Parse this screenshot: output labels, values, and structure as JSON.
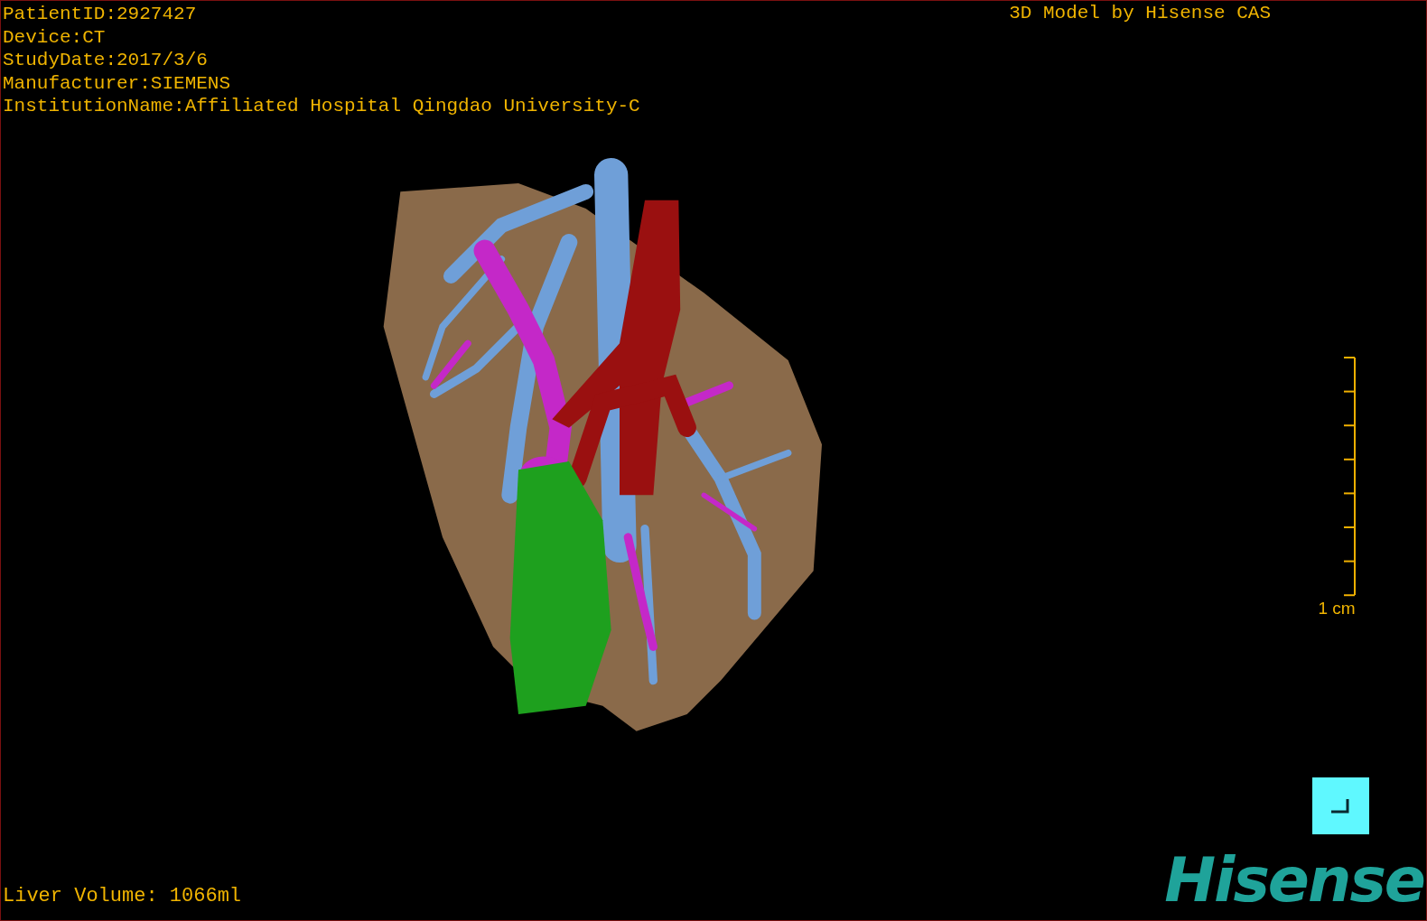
{
  "study_info": [
    "PatientID:2927427",
    "Device:CT",
    "StudyDate:2017/3/6",
    "Manufacturer:SIEMENS",
    "InstitutionName:Affiliated Hospital Qingdao University-C"
  ],
  "viewer_title": "3D Model by Hisense CAS",
  "scale_bar": {
    "label": "1 cm"
  },
  "liver_volume": "Liver Volume: 1066ml",
  "logo": "Hisense"
}
